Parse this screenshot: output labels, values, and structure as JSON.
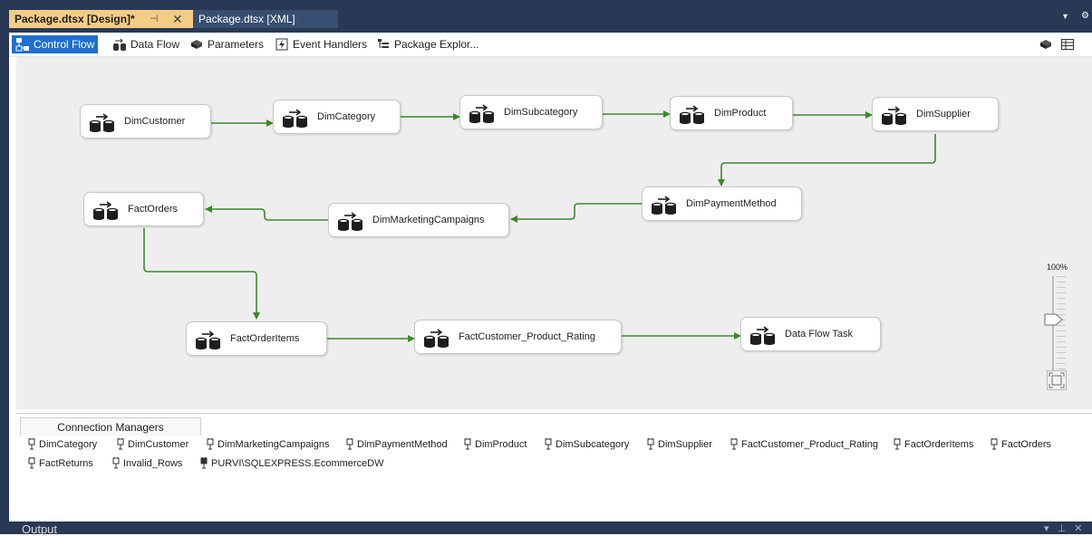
{
  "tabs": [
    {
      "label": "Package.dtsx [Design]*",
      "active": true,
      "pin_glyph": "⊣",
      "close_glyph": "✕"
    },
    {
      "label": "Package.dtsx [XML]",
      "active": false
    }
  ],
  "designer_tabs": [
    {
      "label": "Control Flow",
      "icon": "control-flow-icon",
      "selected": true
    },
    {
      "label": "Data Flow",
      "icon": "data-flow-icon"
    },
    {
      "label": "Parameters",
      "icon": "parameters-icon"
    },
    {
      "label": "Event Handlers",
      "icon": "event-handlers-icon"
    },
    {
      "label": "Package Explor...",
      "icon": "package-explorer-icon"
    }
  ],
  "tasks": [
    {
      "label": "DimCustomer"
    },
    {
      "label": "DimCategory"
    },
    {
      "label": "DimSubcategory"
    },
    {
      "label": "DimProduct"
    },
    {
      "label": "DimSupplier"
    },
    {
      "label": "DimPaymentMethod"
    },
    {
      "label": "DimMarketingCampaigns"
    },
    {
      "label": "FactOrders"
    },
    {
      "label": "FactOrderItems"
    },
    {
      "label": "FactCustomer_Product_Rating"
    },
    {
      "label": "Data Flow Task"
    }
  ],
  "precedence": [
    [
      "DimCustomer",
      "DimCategory"
    ],
    [
      "DimCategory",
      "DimSubcategory"
    ],
    [
      "DimSubcategory",
      "DimProduct"
    ],
    [
      "DimProduct",
      "DimSupplier"
    ],
    [
      "DimSupplier",
      "DimPaymentMethod"
    ],
    [
      "DimPaymentMethod",
      "DimMarketingCampaigns"
    ],
    [
      "DimMarketingCampaigns",
      "FactOrders"
    ],
    [
      "FactOrders",
      "FactOrderItems"
    ],
    [
      "FactOrderItems",
      "FactCustomer_Product_Rating"
    ],
    [
      "FactCustomer_Product_Rating",
      "Data Flow Task"
    ]
  ],
  "zoom": {
    "label": "100%",
    "level_percent": 100
  },
  "connection_managers": {
    "tab_label": "Connection Managers",
    "items": [
      "DimCategory",
      "DimCustomer",
      "DimMarketingCampaigns",
      "DimPaymentMethod",
      "DimProduct",
      "DimSubcategory",
      "DimSupplier",
      "FactCustomer_Product_Rating",
      "FactOrderItems",
      "FactOrders",
      "FactReturns",
      "Invalid_Rows",
      "PURVI\\SQLEXPRESS.EcommerceDW"
    ]
  },
  "output": {
    "label": "Output"
  },
  "colors": {
    "chrome": "#293955",
    "active_tab": "#f5cc84",
    "selected_designer_tab": "#1e6fcf",
    "canvas": "#eeeeee",
    "precedence_success": "#3a8a2b"
  }
}
